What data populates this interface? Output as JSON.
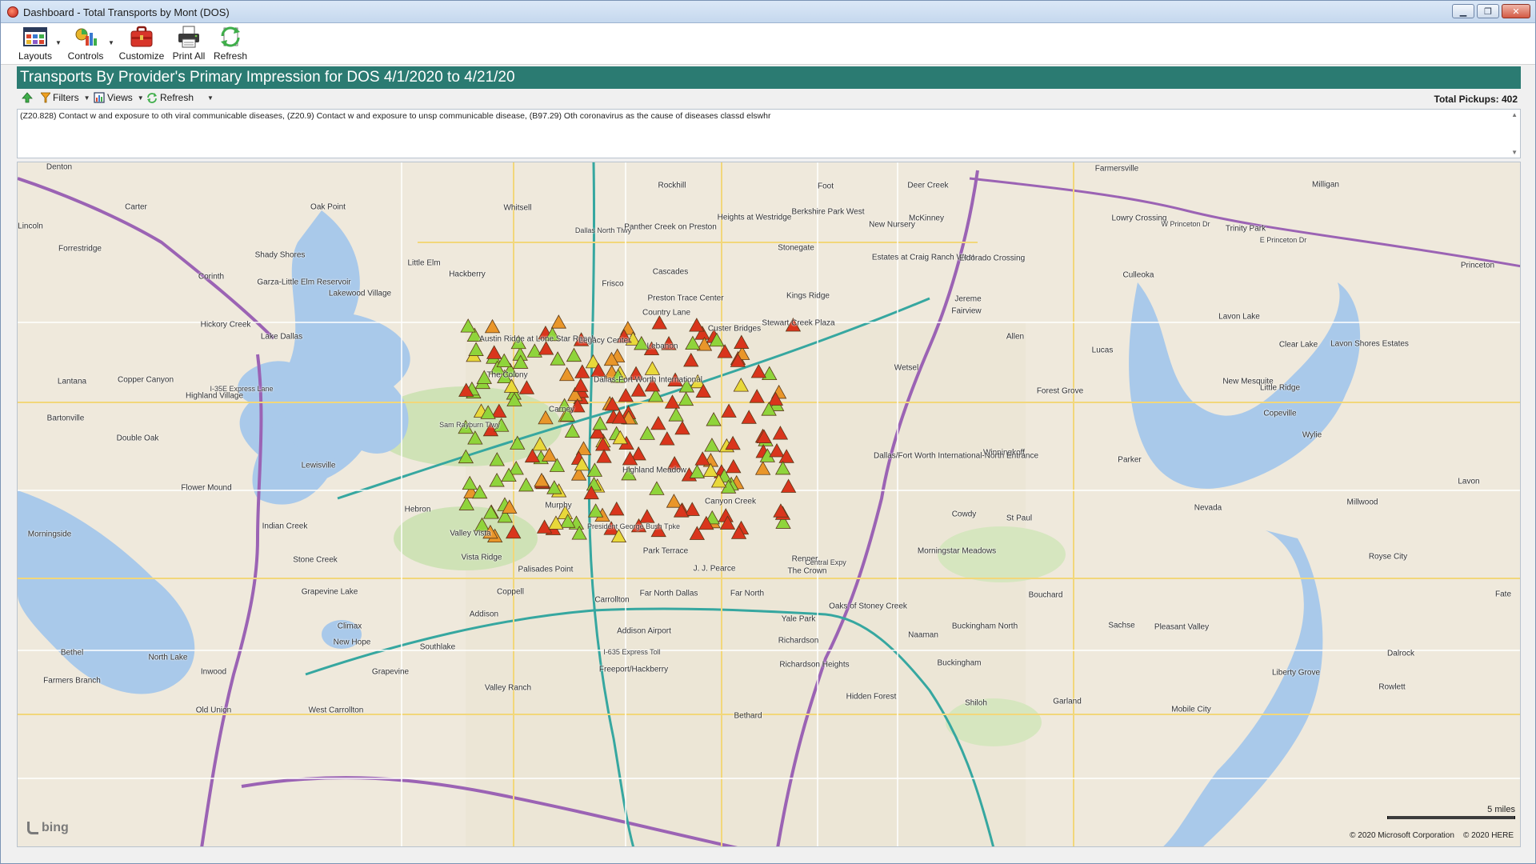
{
  "window": {
    "title": "Dashboard - Total Transports by Mont (DOS)",
    "controls": [
      "minimize",
      "restore",
      "close"
    ]
  },
  "ribbon": {
    "buttons": [
      {
        "label": "Layouts",
        "icon": "layouts-icon"
      },
      {
        "label": "Controls",
        "icon": "controls-icon"
      },
      {
        "label": "Customize",
        "icon": "customize-icon"
      },
      {
        "label": "Print All",
        "icon": "print-icon"
      },
      {
        "label": "Refresh",
        "icon": "refresh-icon"
      }
    ]
  },
  "header": {
    "title": "Transports By Provider's Primary Impression for DOS 4/1/2020 to 4/21/20",
    "color": "#2b7b72"
  },
  "filterbar": {
    "filters_label": "Filters",
    "views_label": "Views",
    "refresh_label": "Refresh",
    "total_label": "Total Pickups:",
    "total_value": "402"
  },
  "description": {
    "text": "(Z20.828) Contact w and exposure to oth viral communicable diseases, (Z20.9) Contact w and exposure to unsp communicable disease, (B97.29) Oth coronavirus as the cause of diseases classd elswhr"
  },
  "map": {
    "provider": "bing",
    "scale_label": "5 miles",
    "copyright_microsoft": "© 2020 Microsoft Corporation",
    "copyright_here": "© 2020 HERE",
    "marker_colors": {
      "high": "#d9351c",
      "orange": "#e9962a",
      "medium": "#e8d83a",
      "low": "#8fd43b"
    },
    "places": [
      "Denton",
      "Carter",
      "Oak Point",
      "Lincoln",
      "Forrestridge",
      "Shady Shores",
      "Corinth",
      "Garza-Little Elm Reservoir",
      "Little Elm",
      "Hackberry",
      "Lakewood Village",
      "Hickory Creek",
      "Lake Dallas",
      "Copper Canyon",
      "Lantana",
      "Highland Village",
      "Bartonville",
      "Double Oak",
      "Flower Mound",
      "Lewisville",
      "The Colony",
      "Austin Ridge at Lone Star Ranch",
      "Legacy Center",
      "Frisco",
      "Lebanon",
      "Carney",
      "Whitsell",
      "Rockhill",
      "Panther Creek on Preston",
      "Heights at Westridge",
      "Berkshire Park West",
      "Foot",
      "Deer Creek",
      "McKinney",
      "New Nursery",
      "Stonegate",
      "Cascades",
      "Preston Trace Center",
      "Kings Ridge",
      "Estates at Craig Ranch West",
      "Eldorado Crossing",
      "Country Lane",
      "Stewart Creek Plaza",
      "Custer Bridges",
      "Jereme",
      "Fairview",
      "Wetsel",
      "Allen",
      "Forest Grove",
      "Lucas",
      "Winningkoff",
      "Parker",
      "St Paul",
      "Murphy",
      "Hebron",
      "Indian Creek",
      "Valley Vista",
      "Stone Creek",
      "Vista Ridge",
      "Palisades Point",
      "Morningside",
      "Grapevine Lake",
      "Coppell",
      "Carrollton",
      "Addison Airport",
      "Addison",
      "Park Terrace",
      "Far North Dallas",
      "Far North",
      "J. J. Pearce",
      "Renner",
      "The Crown",
      "Canyon Creek",
      "Cowdy",
      "Morningstar Meadows",
      "Oaks of Stoney Creek",
      "Yale Park",
      "Richardson",
      "Richardson Heights",
      "Buckingham",
      "Buckingham North",
      "Naaman",
      "Shiloh",
      "Garland",
      "Hidden Forest",
      "Bethard",
      "Bouchard",
      "Sachse",
      "Pleasant Valley",
      "Liberty Grove",
      "Rowlett",
      "Mobile City",
      "Dalrock",
      "Fate",
      "Royse City",
      "Millwood",
      "Lavon",
      "Nevada",
      "Wylie",
      "Copeville",
      "Little Ridge",
      "Clear Lake",
      "Lavon Shores Estates",
      "Lavon Lake",
      "New Mesquite",
      "Culleoka",
      "Trinity Park",
      "Lowry Crossing",
      "Princeton",
      "Milligan",
      "Farmersville",
      "Climax",
      "New Hope",
      "Bethel",
      "North Lake",
      "Southlake",
      "Grapevine",
      "West Carrollton",
      "Valley Ranch",
      "Freeport/Hackberry",
      "Farmers Branch",
      "Inwood",
      "Old Union",
      "Dallas/Fort Worth International-North Entrance",
      "Dallas-Fort Worth International",
      "Highland Meadow",
      "Frisco Bridges",
      "Leach"
    ],
    "roads": [
      "Sam Rayburn Tlwy",
      "President George Bush Tpke",
      "Dallas North Tlwy",
      "Central Expy",
      "I-635 Express Toll",
      "W Princeton Dr",
      "E Princeton Dr",
      "I-35E Express Lane"
    ]
  }
}
